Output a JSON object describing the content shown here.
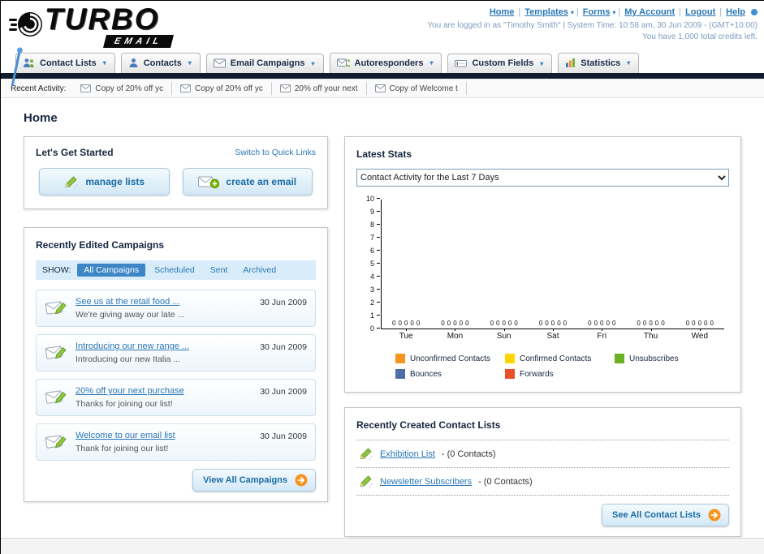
{
  "header": {
    "logo_title": "TURBO",
    "logo_subtitle": "EMAIL",
    "nav_links": [
      {
        "label": "Home",
        "dropdown": false
      },
      {
        "label": "Templates",
        "dropdown": true
      },
      {
        "label": "Forms",
        "dropdown": true
      },
      {
        "label": "My Account",
        "dropdown": false
      },
      {
        "label": "Logout",
        "dropdown": false
      },
      {
        "label": "Help",
        "dropdown": false
      }
    ],
    "login_info": "You are logged in as \"Timothy Smith\" | System Time: 10:58 am, 30 Jun 2009 - (GMT+10:00)",
    "credits_info": "You have 1,000 total credits left."
  },
  "main_nav": {
    "items": [
      {
        "label": "Contact Lists",
        "icon": "contact-lists-icon"
      },
      {
        "label": "Contacts",
        "icon": "contacts-icon"
      },
      {
        "label": "Email Campaigns",
        "icon": "email-campaigns-icon"
      },
      {
        "label": "Autoresponders",
        "icon": "autoresponders-icon"
      },
      {
        "label": "Custom Fields",
        "icon": "custom-fields-icon"
      },
      {
        "label": "Statistics",
        "icon": "statistics-icon"
      }
    ]
  },
  "recent_activity": {
    "label": "Recent Activity:",
    "items": [
      {
        "label": "Copy of 20% off yc",
        "icon": "envelope-icon"
      },
      {
        "label": "Copy of 20% off yc",
        "icon": "envelope-icon"
      },
      {
        "label": "20% off your next",
        "icon": "envelope-icon"
      },
      {
        "label": "Copy of Welcome t",
        "icon": "envelope-icon"
      }
    ]
  },
  "page_title": "Home",
  "get_started": {
    "title": "Let's Get Started",
    "switch_link": "Switch to Quick Links",
    "buttons": [
      {
        "label": "manage lists",
        "icon": "pencil-icon"
      },
      {
        "label": "create an email",
        "icon": "envelope-plus-icon"
      }
    ]
  },
  "campaigns": {
    "title": "Recently Edited Campaigns",
    "show_label": "SHOW:",
    "tabs": [
      "All Campaigns",
      "Scheduled",
      "Sent",
      "Archived"
    ],
    "selected_tab": "All Campaigns",
    "items": [
      {
        "title": "See us at the retail food ...",
        "subtitle": "We're giving away our late ...",
        "date": "30 Jun 2009"
      },
      {
        "title": "Introducing our new range ...",
        "subtitle": "Introducing our new Italia ...",
        "date": "30 Jun 2009"
      },
      {
        "title": "20% off your next purchase",
        "subtitle": "Thanks for joining our list!",
        "date": "30 Jun 2009"
      },
      {
        "title": "Welcome to our email list",
        "subtitle": "Thank for joining our list!",
        "date": "30 Jun 2009"
      }
    ],
    "view_all": {
      "label": "View All Campaigns",
      "icon": "orange-arrow-icon"
    }
  },
  "stats": {
    "title": "Latest Stats",
    "dropdown_value": "Contact Activity for the Last 7 Days",
    "chart_data": {
      "type": "bar",
      "categories": [
        "Tue",
        "Mon",
        "Sun",
        "Sat",
        "Fri",
        "Thu",
        "Wed"
      ],
      "series": [
        {
          "name": "Unconfirmed Contacts",
          "color": "#f7941d",
          "values": [
            0,
            0,
            0,
            0,
            0,
            0,
            0
          ]
        },
        {
          "name": "Confirmed Contacts",
          "color": "#ffd400",
          "values": [
            0,
            0,
            0,
            0,
            0,
            0,
            0
          ]
        },
        {
          "name": "Unsubscribes",
          "color": "#6ab023",
          "values": [
            0,
            0,
            0,
            0,
            0,
            0,
            0
          ]
        },
        {
          "name": "Bounces",
          "color": "#4f6ea8",
          "values": [
            0,
            0,
            0,
            0,
            0,
            0,
            0
          ]
        },
        {
          "name": "Forwards",
          "color": "#e8502a",
          "values": [
            0,
            0,
            0,
            0,
            0,
            0,
            0
          ]
        }
      ],
      "ylim": [
        0,
        10
      ],
      "yticks": [
        0,
        1,
        2,
        3,
        4,
        5,
        6,
        7,
        8,
        9,
        10
      ],
      "grid": false,
      "legend_position": "bottom"
    }
  },
  "contact_lists": {
    "title": "Recently Created Contact Lists",
    "items": [
      {
        "name": "Exhibition List",
        "detail": "- (0 Contacts)",
        "icon": "pencil-icon"
      },
      {
        "name": "Newsletter Subscribers",
        "detail": "- (0 Contacts)",
        "icon": "pencil-icon"
      }
    ],
    "see_all": {
      "label": "See All Contact Lists",
      "icon": "orange-arrow-icon"
    }
  }
}
